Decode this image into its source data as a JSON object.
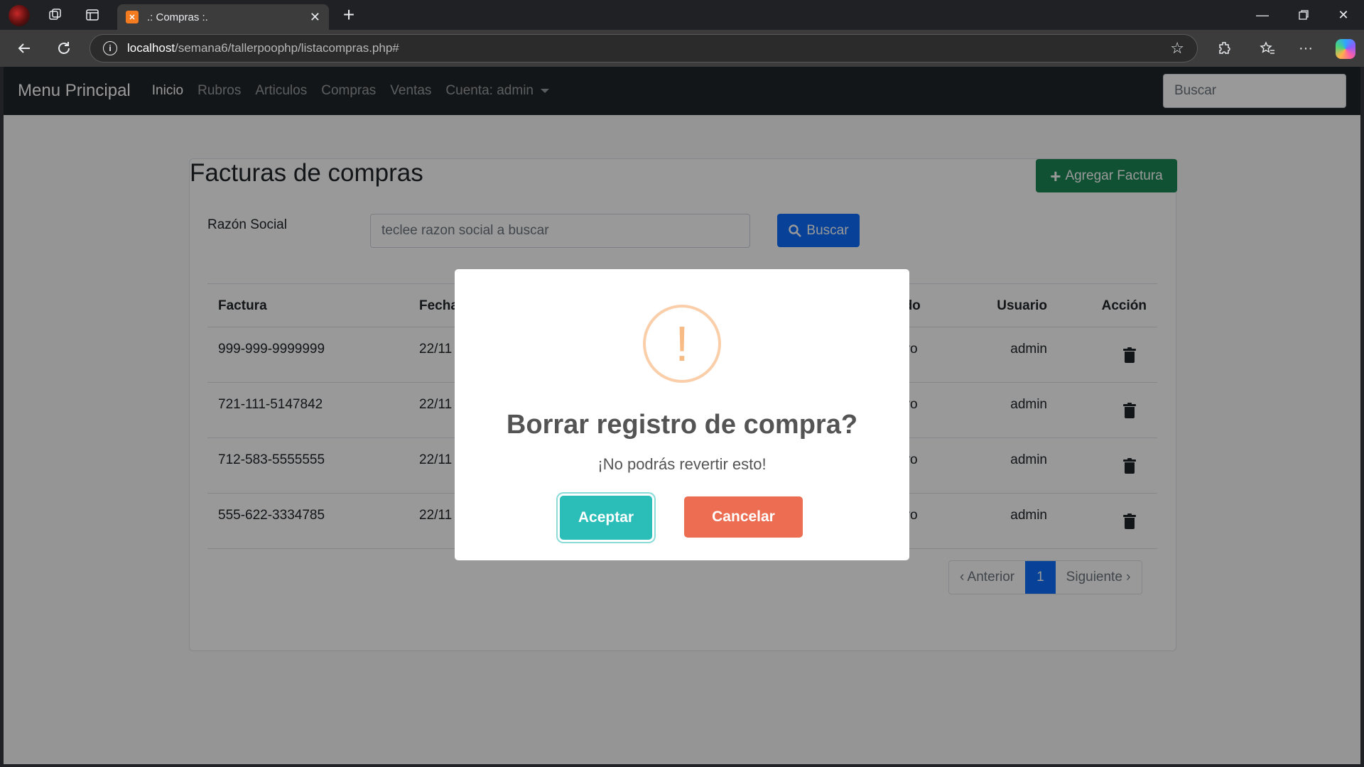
{
  "browser": {
    "tab_title": ".: Compras :.",
    "favicon_text": "✕",
    "url_host": "localhost",
    "url_path": "/semana6/tallerpoophp/listacompras.php#"
  },
  "navbar": {
    "brand": "Menu Principal",
    "links": [
      "Inicio",
      "Rubros",
      "Articulos",
      "Compras",
      "Ventas",
      "Cuenta: admin"
    ],
    "active": "Inicio",
    "search_placeholder": "Buscar"
  },
  "main": {
    "title": "Facturas de compras",
    "add_button": "Agregar Factura",
    "search_label": "Razón Social",
    "search_placeholder": "teclee razon social a buscar",
    "search_button": "Buscar"
  },
  "table": {
    "headers": {
      "factura": "Factura",
      "fecha": "Fecha",
      "estado": "ado",
      "usuario": "Usuario",
      "accion": "Acción"
    },
    "rows": [
      {
        "factura": "999-999-9999999",
        "fecha": "22/11",
        "estado": "tivo",
        "usuario": "admin"
      },
      {
        "factura": "721-111-5147842",
        "fecha": "22/11",
        "estado": "tivo",
        "usuario": "admin"
      },
      {
        "factura": "712-583-5555555",
        "fecha": "22/11",
        "estado": "tivo",
        "usuario": "admin"
      },
      {
        "factura": "555-622-3334785",
        "fecha": "22/11",
        "estado": "tivo",
        "usuario": "admin"
      }
    ]
  },
  "pagination": {
    "prev": "‹ Anterior",
    "current": "1",
    "next": "Siguiente ›"
  },
  "modal": {
    "icon": "!",
    "title": "Borrar registro de compra?",
    "text": "¡No podrás revertir esto!",
    "confirm": "Aceptar",
    "cancel": "Cancelar"
  }
}
